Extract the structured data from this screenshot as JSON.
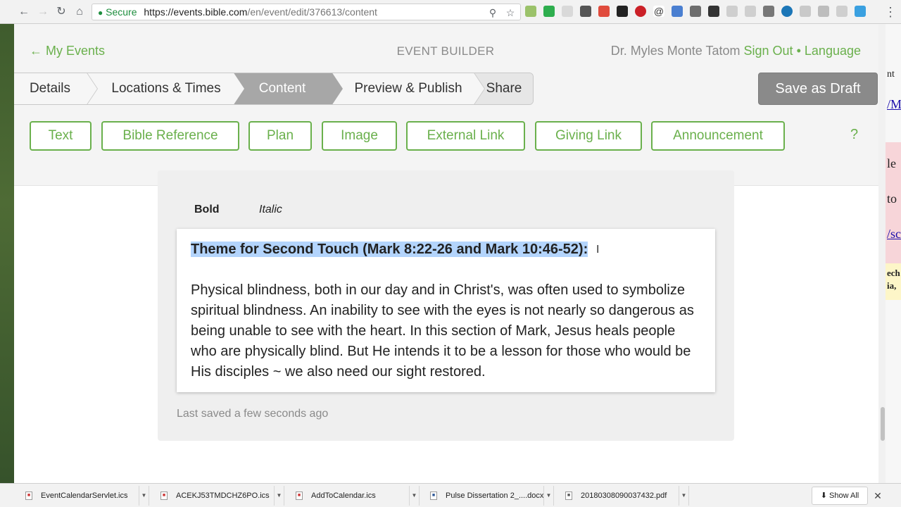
{
  "browser": {
    "secure_label": "Secure",
    "url_host": "https://events.bible.com",
    "url_path": "/en/event/edit/376613/content"
  },
  "header": {
    "back_link": "← My Events",
    "title": "EVENT BUILDER",
    "user_name": "Dr. Myles Monte Tatom",
    "sign_out": "Sign Out",
    "separator": "•",
    "language": "Language"
  },
  "steps": [
    {
      "label": "Details"
    },
    {
      "label": "Locations & Times"
    },
    {
      "label": "Content"
    },
    {
      "label": "Preview & Publish"
    },
    {
      "label": "Share"
    }
  ],
  "active_step": "Content",
  "save_draft_label": "Save as Draft",
  "content_types": [
    {
      "label": "Text"
    },
    {
      "label": "Bible Reference"
    },
    {
      "label": "Plan"
    },
    {
      "label": "Image"
    },
    {
      "label": "External Link"
    },
    {
      "label": "Giving Link"
    },
    {
      "label": "Announcement"
    }
  ],
  "help_label": "?",
  "editor": {
    "bold_label": "Bold",
    "italic_label": "Italic",
    "heading": "Theme for Second Touch (Mark 8:22-26 and Mark 10:46-52):",
    "body": "Physical blindness, both in our day and in Christ's, was often used to symbolize spiritual blindness.  An inability to see with the eyes is not nearly so dangerous as being unable to see with the heart.  In this section of Mark, Jesus heals people who are physically blind.  But He intends it to be a lesson for those who would be His disciples ~ we also need our sight restored.",
    "status": "Last saved a few seconds ago"
  },
  "downloads": [
    {
      "name": "EventCalendarServlet.ics"
    },
    {
      "name": "ACEKJ53TMDCHZ6PO.ics"
    },
    {
      "name": "AddToCalendar.ics"
    },
    {
      "name": "Pulse Dissertation 2_....docx"
    },
    {
      "name": "20180308090037432.pdf"
    }
  ],
  "show_all_label": "Show All",
  "side_page_fragments": [
    "nt",
    "/M",
    "le",
    "to",
    "/sc",
    "ech",
    "ia,"
  ],
  "colors": {
    "accent_green": "#6ab04c",
    "active_step_bg": "#a7a7a7",
    "save_draft_bg": "#8a8a8a",
    "selection": "#b3d4fc"
  }
}
